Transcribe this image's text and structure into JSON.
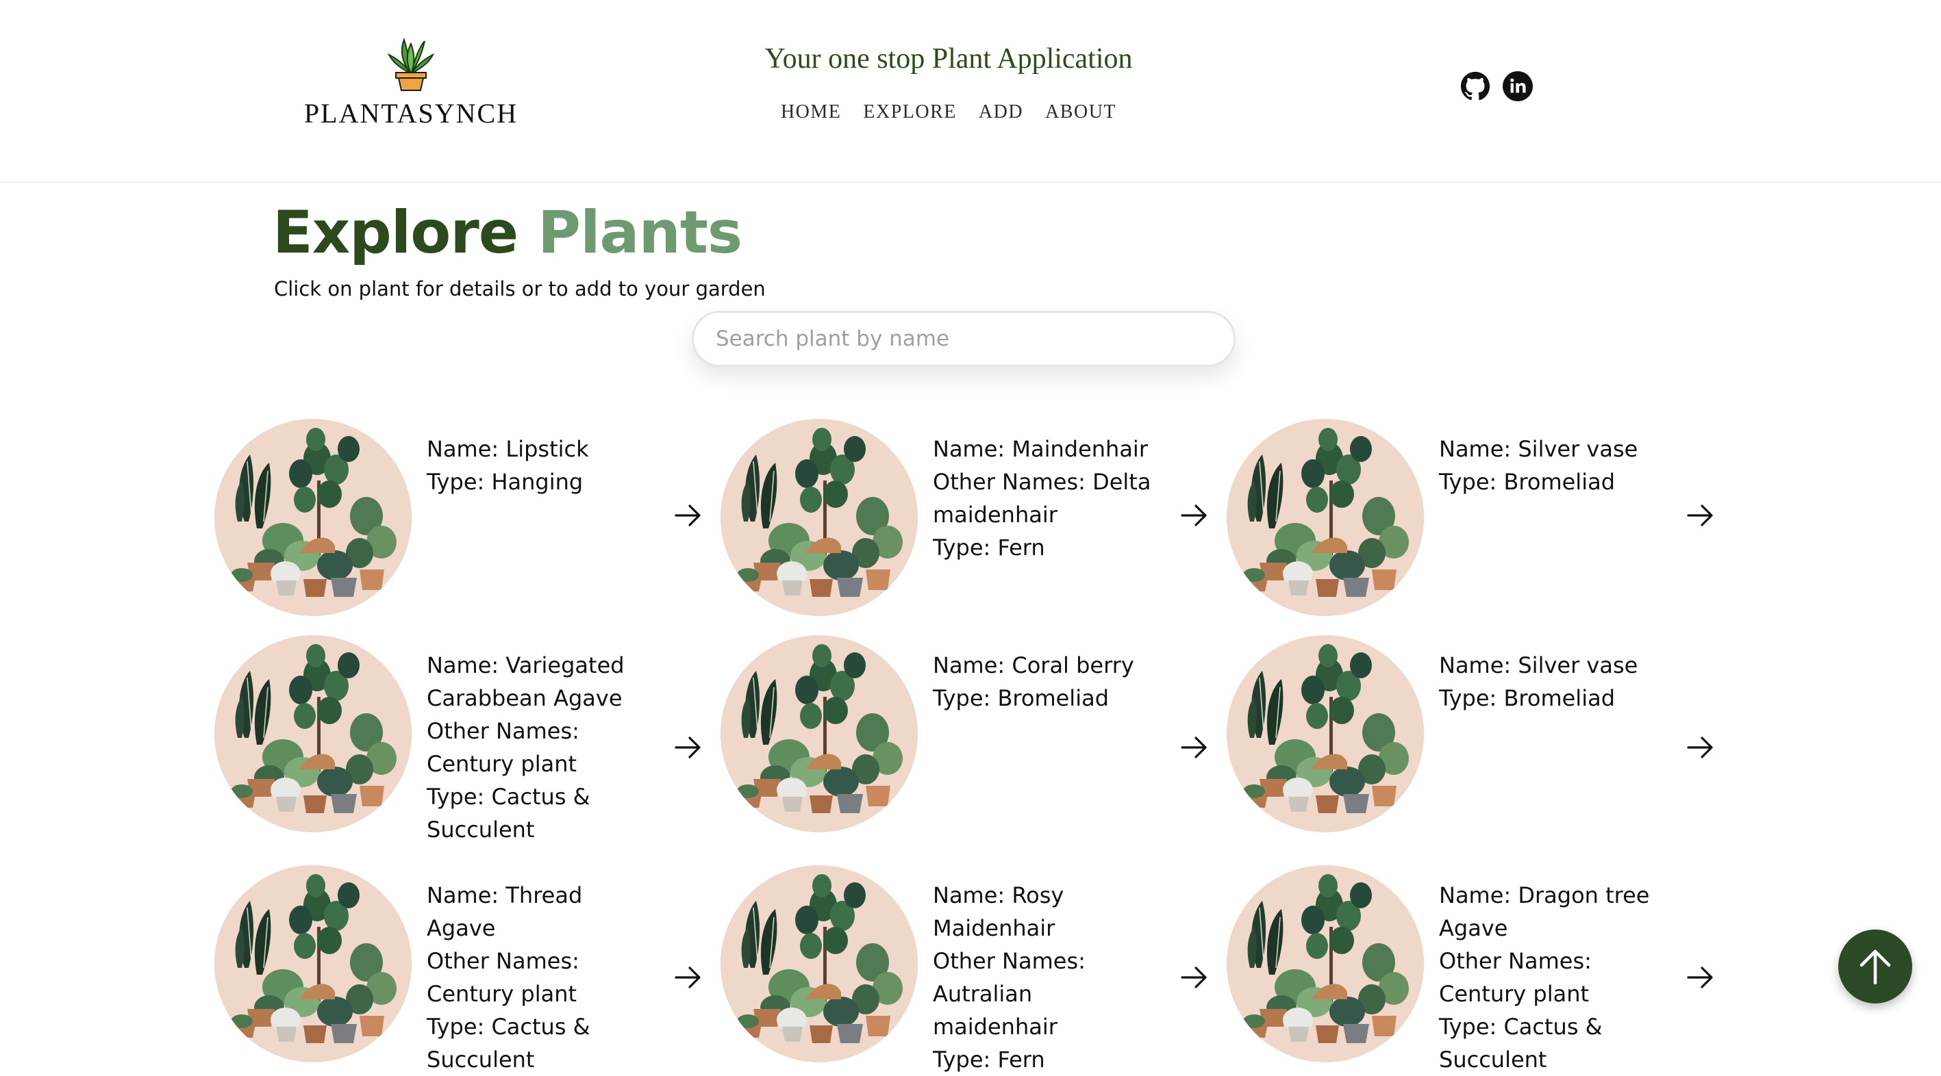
{
  "header": {
    "logo_text": "PLANTASYNCH",
    "tagline": "Your one stop Plant Application",
    "nav": [
      "HOME",
      "EXPLORE",
      "ADD",
      "ABOUT"
    ],
    "social_icons": [
      "github-icon",
      "linkedin-icon"
    ]
  },
  "page": {
    "title_word1": "Explore",
    "title_word2": "Plants",
    "subtitle": "Click on plant for details or to add to your garden",
    "search_placeholder": "Search plant by name"
  },
  "plants": [
    {
      "name": "Name: Lipstick",
      "other": "",
      "type": "Type: Hanging"
    },
    {
      "name": "Name: Maindenhair",
      "other": "Other Names: Delta maidenhair",
      "type": "Type: Fern"
    },
    {
      "name": "Name: Silver vase",
      "other": "",
      "type": "Type: Bromeliad"
    },
    {
      "name": "Name: Variegated Carabbean Agave",
      "other": "Other Names: Century plant",
      "type": "Type: Cactus & Succulent"
    },
    {
      "name": "Name: Coral berry",
      "other": "",
      "type": "Type: Bromeliad"
    },
    {
      "name": "Name: Silver vase",
      "other": "",
      "type": "Type: Bromeliad"
    },
    {
      "name": "Name: Thread Agave",
      "other": "Other Names: Century plant",
      "type": "Type: Cactus & Succulent"
    },
    {
      "name": "Name: Rosy Maidenhair",
      "other": "Other Names: Autralian maidenhair",
      "type": "Type: Fern"
    },
    {
      "name": "Name: Dragon tree Agave",
      "other": "Other Names: Century plant",
      "type": "Type: Cactus & Succulent"
    }
  ],
  "colors": {
    "brand_dark_green": "#2c4a1e",
    "brand_light_green": "#6e9a72",
    "thumb_background": "#efd7ca",
    "back_to_top": "#2b4a25"
  },
  "icons": {
    "card_arrow": "arrow-right-icon",
    "back_to_top": "arrow-up-icon",
    "logo": "potted-plant-icon"
  }
}
